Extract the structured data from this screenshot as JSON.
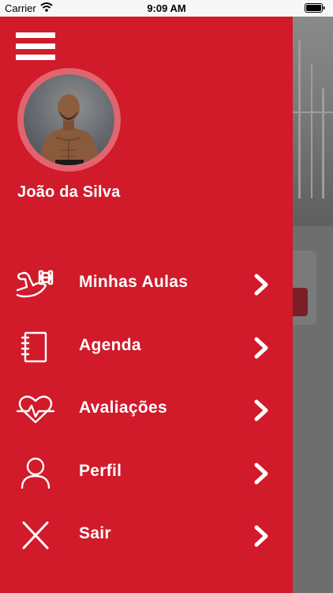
{
  "status_bar": {
    "carrier": "Carrier",
    "time": "9:09 AM"
  },
  "drawer": {
    "user_name": "João da Silva",
    "menu": [
      {
        "label": "Minhas Aulas",
        "icon": "muscle-dumbbell-icon"
      },
      {
        "label": "Agenda",
        "icon": "notebook-icon"
      },
      {
        "label": "Avaliações",
        "icon": "heart-pulse-icon"
      },
      {
        "label": "Perfil",
        "icon": "user-icon"
      },
      {
        "label": "Sair",
        "icon": "close-icon"
      }
    ]
  },
  "colors": {
    "drawer_bg": "#d11a2a",
    "avatar_ring": "#e2646f",
    "text": "#ffffff"
  }
}
